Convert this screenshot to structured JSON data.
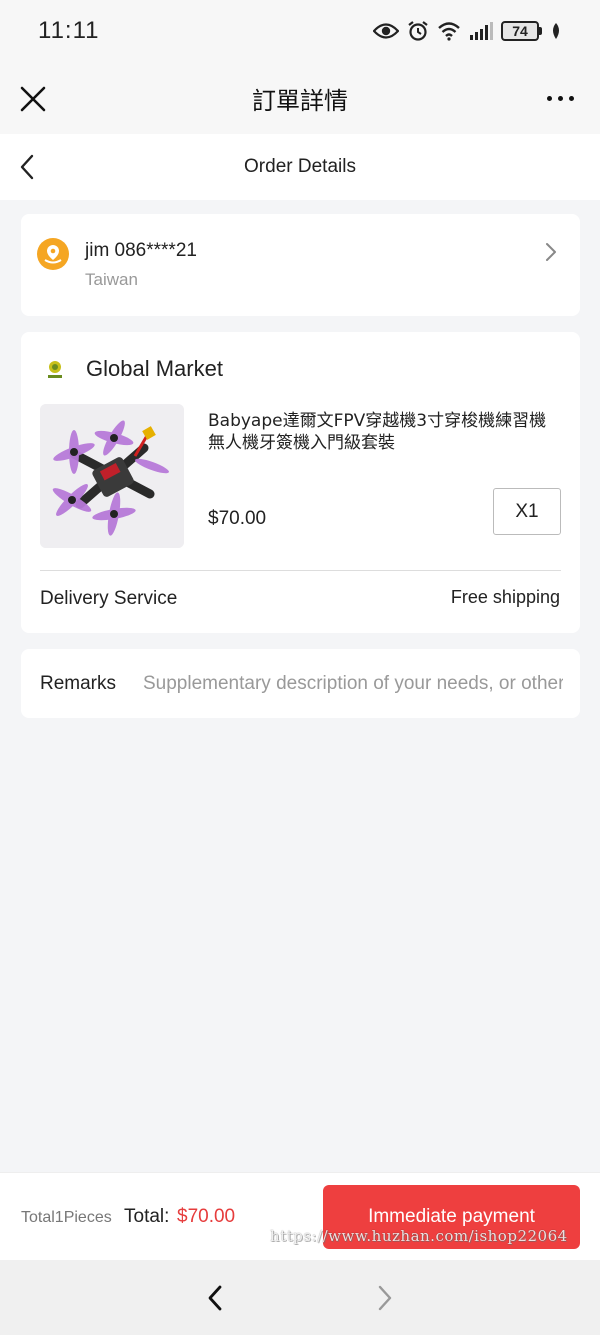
{
  "status_bar": {
    "time": "11:11",
    "battery": "74",
    "icons": [
      "eye-icon",
      "alarm-icon",
      "wifi-icon",
      "signal-icon",
      "battery-icon",
      "leaf-icon"
    ]
  },
  "title_bar": {
    "title": "訂單詳情",
    "close_icon": "close-icon",
    "more_icon": "more-icon"
  },
  "header": {
    "title": "Order Details",
    "back_icon": "chevron-left-icon"
  },
  "address": {
    "name": "jim 086****21",
    "region": "Taiwan",
    "icon": "location-icon"
  },
  "order": {
    "store_name": "Global Market",
    "product_title": "Babyape達爾文FPV穿越機3寸穿梭機練習機無人機牙簽機入門級套裝",
    "price": "$70.00",
    "quantity": "X1",
    "delivery_label": "Delivery Service",
    "delivery_value": "Free shipping"
  },
  "remarks": {
    "label": "Remarks",
    "placeholder": "Supplementary description of your needs, or other"
  },
  "checkout": {
    "count_text": "Total1Pieces",
    "total_label": "Total:",
    "total_value": "$70.00",
    "pay_label": "Immediate payment",
    "watermark": "https://www.huzhan.com/ishop22064"
  },
  "colors": {
    "accent": "#ee3f3f",
    "price_red": "#e63c3c",
    "location_orange": "#f5a623"
  }
}
